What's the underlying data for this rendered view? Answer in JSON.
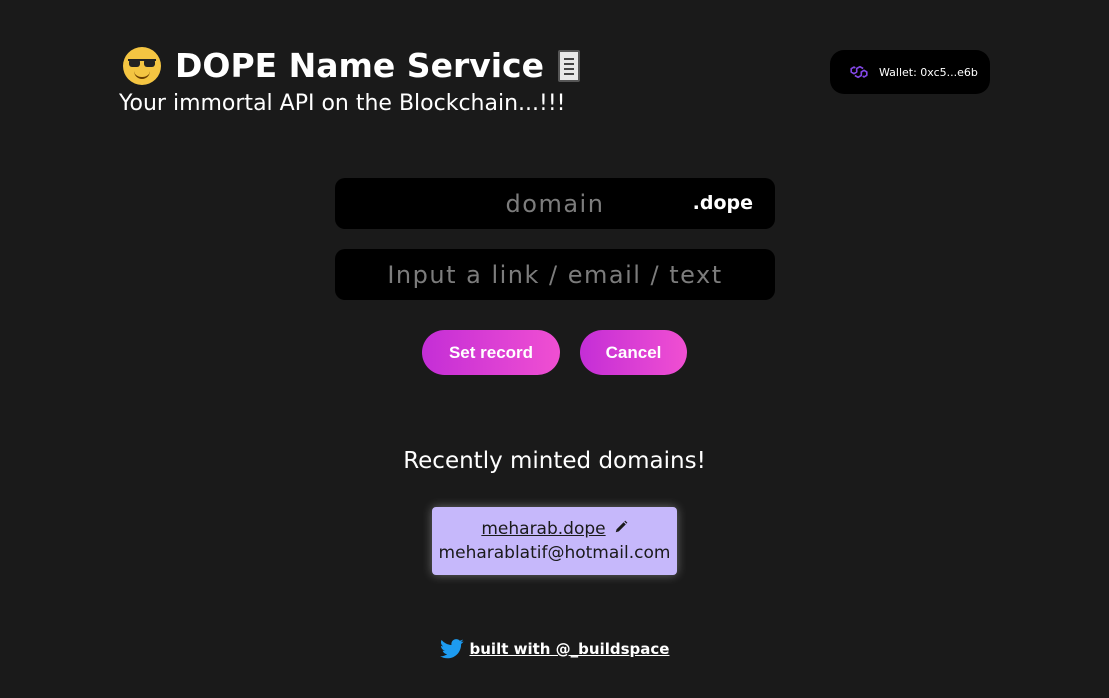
{
  "header": {
    "title": "DOPE Name Service",
    "subtitle": "Your immortal API on the Blockchain...!!!",
    "title_emoji_icon": "sunglasses-face-icon",
    "title_doc_icon": "document-icon"
  },
  "wallet": {
    "label": "Wallet: 0xc5...e6b",
    "icon": "polygon-icon",
    "icon_color": "#8247e5"
  },
  "form": {
    "domain_placeholder": "domain",
    "domain_value": "",
    "domain_suffix": ".dope",
    "record_placeholder": "Input a link / email / text",
    "record_value": "",
    "set_record_label": "Set record",
    "cancel_label": "Cancel"
  },
  "minted": {
    "heading": "Recently minted domains!",
    "items": [
      {
        "domain": "meharab.dope",
        "record": "meharablatif@hotmail.com",
        "edit_icon": "pencil-icon"
      }
    ]
  },
  "footer": {
    "link_text": "built with @_buildspace",
    "icon": "twitter-icon"
  },
  "colors": {
    "background": "#1a1a1a",
    "field_bg": "#000000",
    "button_gradient_start": "#c42ed6",
    "button_gradient_end": "#f04fd2",
    "card_bg": "#c6b8fb",
    "twitter_blue": "#1d9bf0"
  }
}
